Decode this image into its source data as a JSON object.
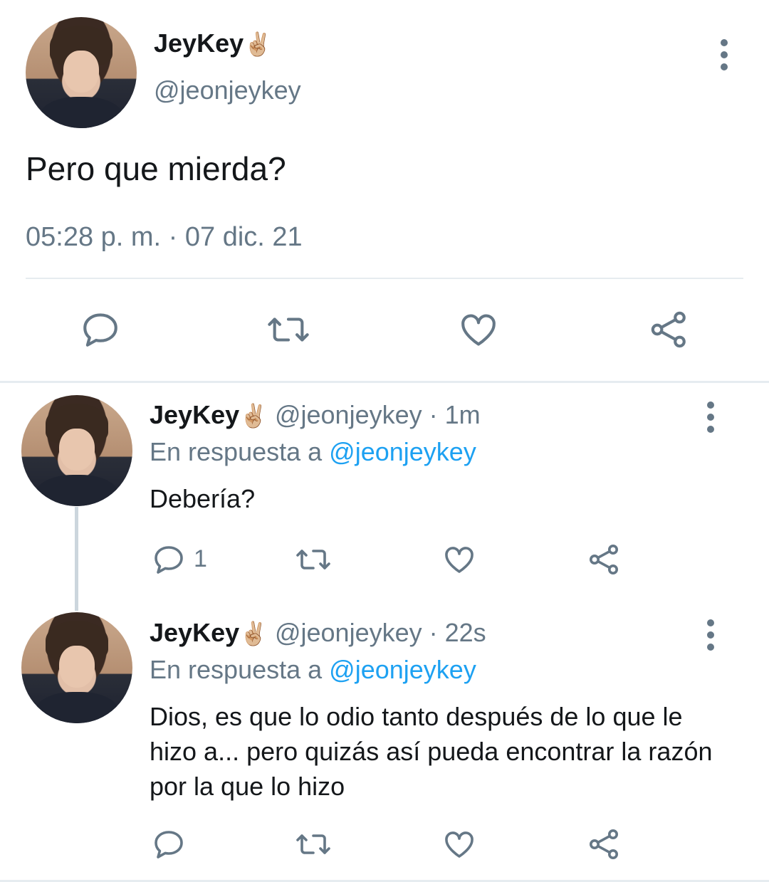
{
  "tweet": {
    "author_name": "JeyKey",
    "author_emoji": "✌🏼",
    "author_handle": "@jeonjeykey",
    "text": "Pero que mierda?",
    "timestamp": "05:28 p. m. · 07 dic. 21",
    "actions": [
      "reply-icon",
      "retweet-icon",
      "like-icon",
      "share-icon"
    ]
  },
  "replies": [
    {
      "author_name": "JeyKey",
      "author_emoji": "✌🏼",
      "author_handle": "@jeonjeykey",
      "time_ago": "· 1m",
      "in_reply_prefix": "En respuesta a ",
      "in_reply_mention": "@jeonjeykey",
      "text": "Debería?",
      "reply_count": "1"
    },
    {
      "author_name": "JeyKey",
      "author_emoji": "✌🏼",
      "author_handle": "@jeonjeykey",
      "time_ago": "· 22s",
      "in_reply_prefix": "En respuesta a ",
      "in_reply_mention": "@jeonjeykey",
      "text": "Dios, es que lo odio tanto después de lo que le hizo a... pero quizás así pueda encontrar la razón por la que lo hizo",
      "reply_count": ""
    }
  ],
  "colors": {
    "text": "#14171a",
    "secondary": "#657786",
    "accent": "#1da1f2",
    "divider": "#e6ecf0"
  }
}
